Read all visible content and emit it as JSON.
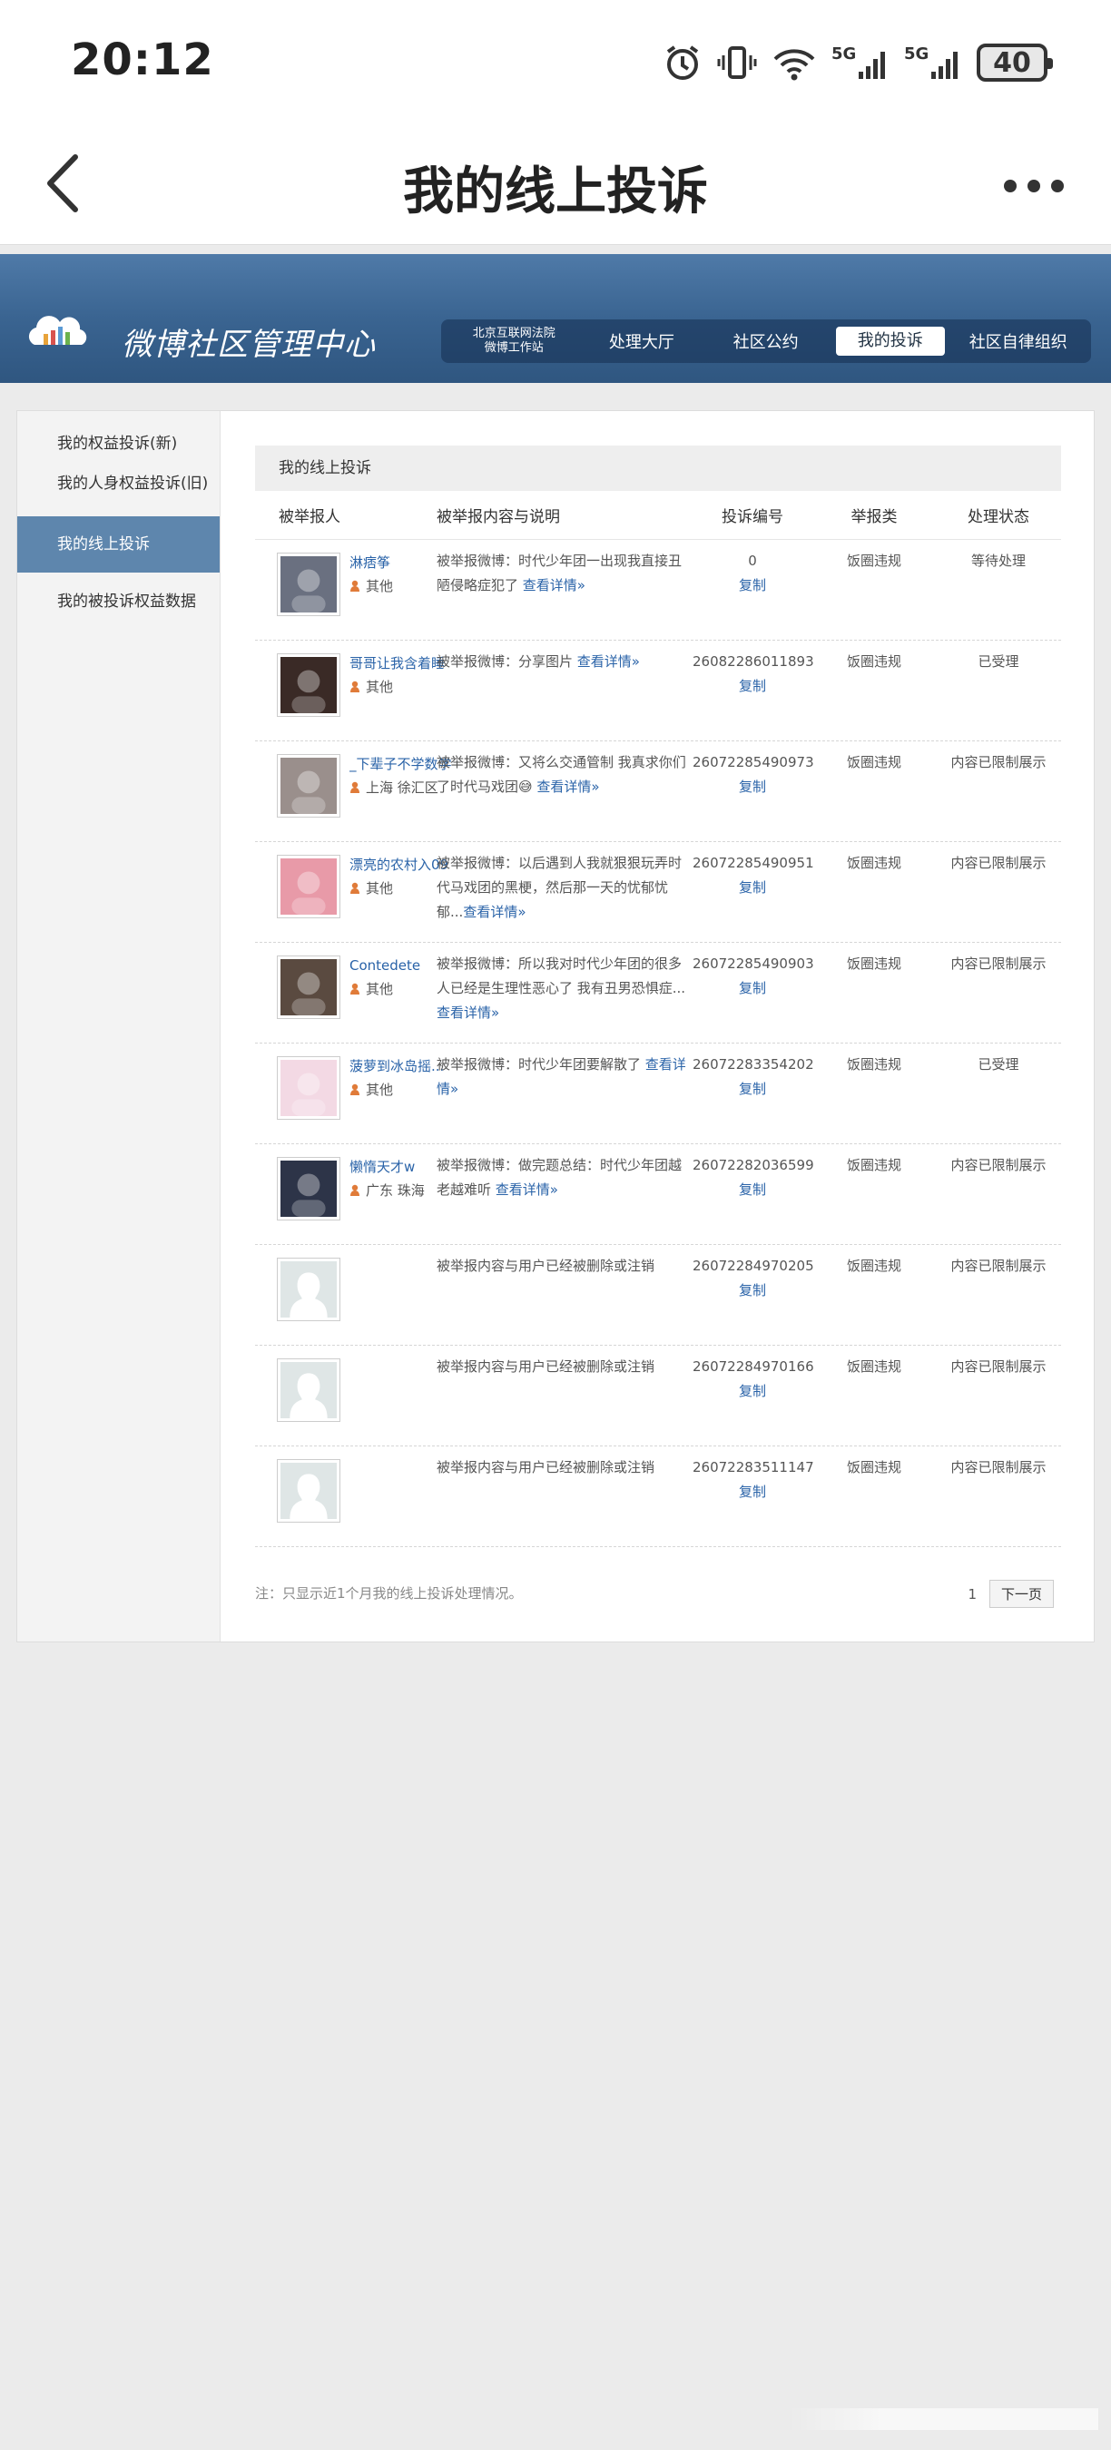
{
  "status_bar": {
    "time": "20:12",
    "battery": "40"
  },
  "app_header": {
    "title": "我的线上投诉"
  },
  "weibo": {
    "brand": "微博社区管理中心",
    "nav_first_line1": "北京互联网法院",
    "nav_first_line2": "微博工作站",
    "nav": [
      "处理大厅",
      "社区公约",
      "我的投诉",
      "社区自律组织"
    ]
  },
  "sidebar": {
    "items": [
      "我的权益投诉(新)",
      "我的人身权益投诉(旧)",
      "我的线上投诉",
      "我的被投诉权益数据"
    ]
  },
  "content": {
    "title": "我的线上投诉",
    "headers": [
      "被举报人",
      "被举报内容与说明",
      "投诉编号",
      "举报类",
      "处理状态"
    ],
    "detail_label": "查看详情»",
    "copy_label": "复制",
    "rows": [
      {
        "name": "淋痞筝",
        "location": "其他",
        "desc": "被举报微博：时代少年团一出现我直接丑陋侵略症犯了 ",
        "id": "0",
        "type": "饭圈违规",
        "status": "等待处理",
        "avatar": "#6a7080"
      },
      {
        "name": "哥哥让我含着睡",
        "location": "其他",
        "desc": "被举报微博：分享图片 ",
        "id": "26082286011893",
        "type": "饭圈违规",
        "status": "已受理",
        "avatar": "#3a2a26"
      },
      {
        "name": "_下辈子不学数学",
        "location": "上海 徐汇区",
        "desc": "被举报微博：又将么交通管制 我真求你们了时代马戏团😅 ",
        "id": "26072285490973",
        "type": "饭圈违规",
        "status": "内容已限制展示",
        "avatar": "#9a8f8c"
      },
      {
        "name": "漂亮的农村入09",
        "location": "其他",
        "desc": "被举报微博：以后遇到人我就狠狠玩弄时代马戏团的黑梗，然后那一天的忧郁忧郁...",
        "id": "26072285490951",
        "type": "饭圈违规",
        "status": "内容已限制展示",
        "avatar": "#e89aa8"
      },
      {
        "name": "Contedete",
        "location": "其他",
        "desc": "被举报微博：所以我对时代少年团的很多人已经是生理性恶心了 我有丑男恐惧症...",
        "id": "26072285490903",
        "type": "饭圈违规",
        "status": "内容已限制展示",
        "avatar": "#5a4a40"
      },
      {
        "name": "菠萝到冰岛摇...",
        "location": "其他",
        "desc": "被举报微博：时代少年团要解散了 ",
        "id": "26072283354202",
        "type": "饭圈违规",
        "status": "已受理",
        "avatar": "#f3d9e4"
      },
      {
        "name": "懒惰天才w",
        "location": "广东 珠海",
        "desc": "被举报微博：做完题总结：时代少年团越老越难听 ",
        "id": "26072282036599",
        "type": "饭圈违规",
        "status": "内容已限制展示",
        "avatar": "#2d3448"
      },
      {
        "name": "",
        "location": "",
        "desc": "被举报内容与用户已经被删除或注销",
        "id": "26072284970205",
        "type": "饭圈违规",
        "status": "内容已限制展示",
        "avatar": "#dfe6e6"
      },
      {
        "name": "",
        "location": "",
        "desc": "被举报内容与用户已经被删除或注销",
        "id": "26072284970166",
        "type": "饭圈违规",
        "status": "内容已限制展示",
        "avatar": "#dfe6e6"
      },
      {
        "name": "",
        "location": "",
        "desc": "被举报内容与用户已经被删除或注销",
        "id": "26072283511147",
        "type": "饭圈违规",
        "status": "内容已限制展示",
        "avatar": "#dfe6e6"
      }
    ],
    "footnote": "注：只显示近1个月我的线上投诉处理情况。",
    "page": "1",
    "next_label": "下一页"
  }
}
